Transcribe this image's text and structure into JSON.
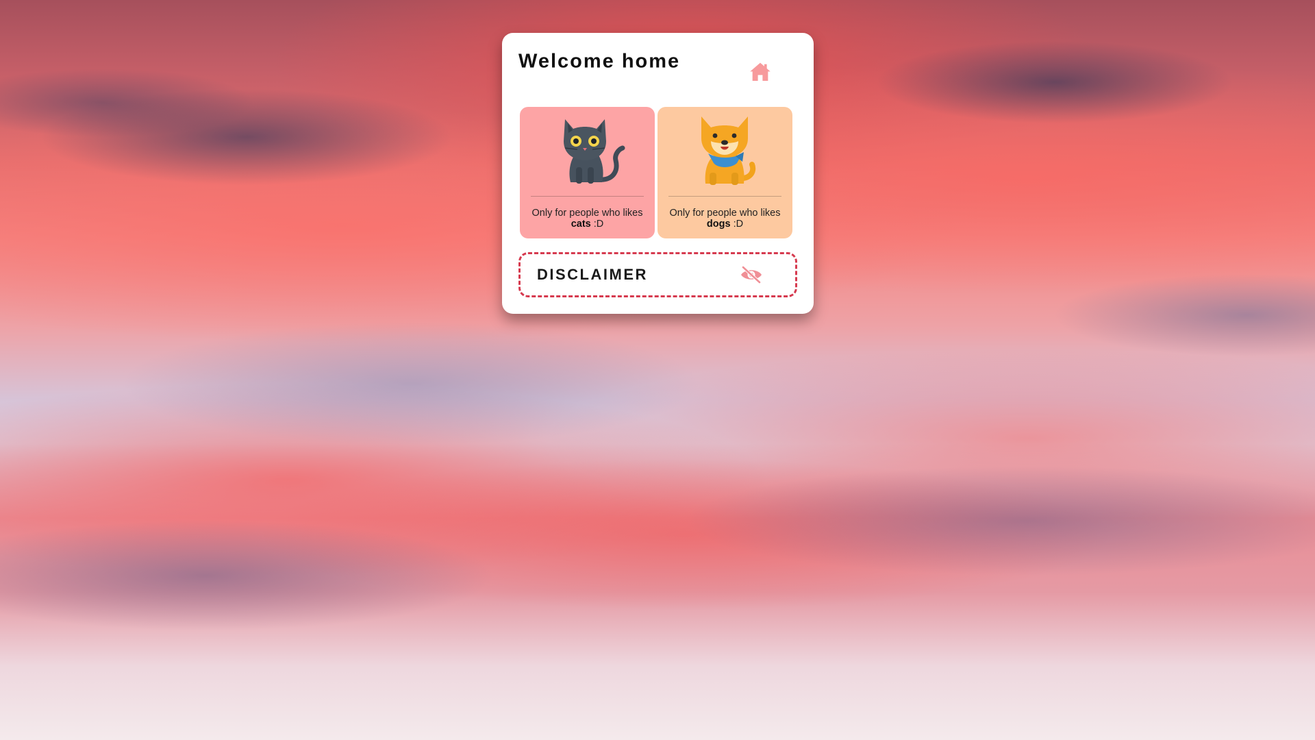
{
  "card": {
    "title": "Welcome home",
    "home_icon": "home-icon",
    "accent_color": "#f79a9c"
  },
  "tiles": [
    {
      "id": "cats",
      "icon": "cat-icon",
      "background": "#fda4a5",
      "caption_prefix": "Only for people who likes ",
      "caption_bold": "cats",
      "caption_suffix": " :D"
    },
    {
      "id": "dogs",
      "icon": "dog-icon",
      "background": "#fdc9a0",
      "caption_prefix": "Only for people who likes ",
      "caption_bold": "dogs",
      "caption_suffix": " :D"
    }
  ],
  "disclaimer": {
    "label": "DISCLAIMER",
    "icon": "eye-slash-icon",
    "border_color": "#d63a4f"
  }
}
